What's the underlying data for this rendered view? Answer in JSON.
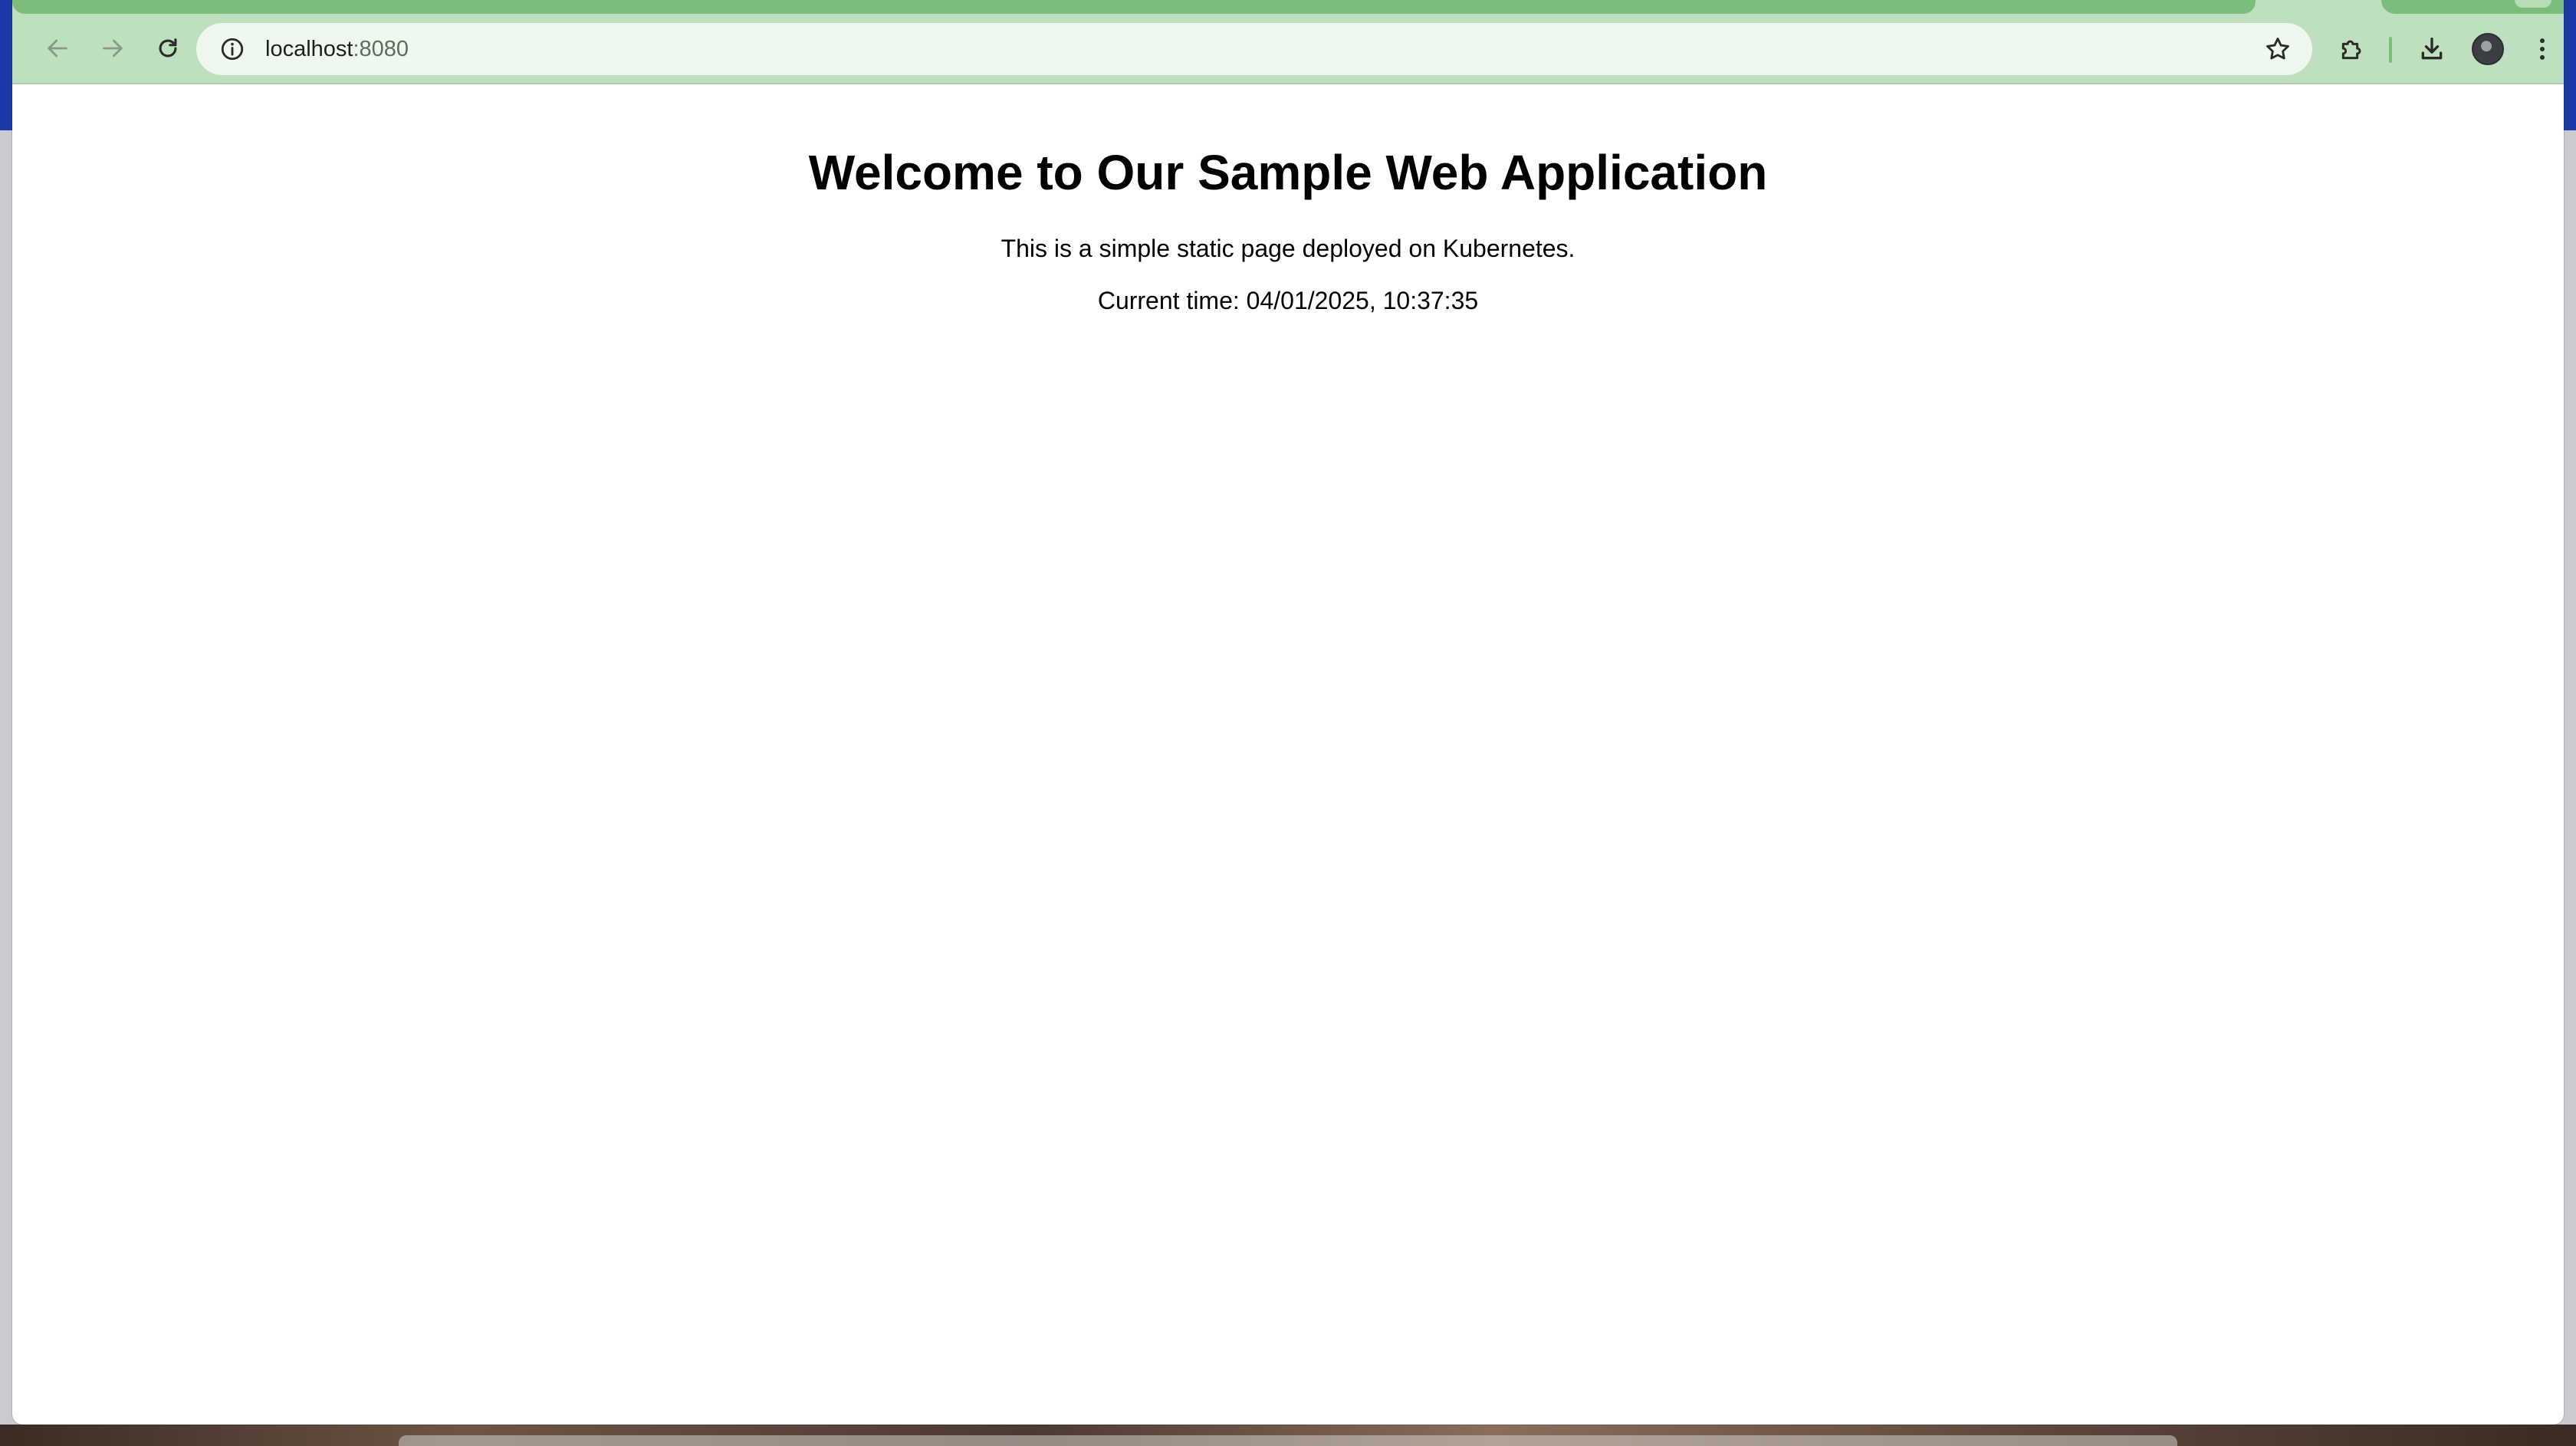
{
  "browser": {
    "address_bar": {
      "host": "localhost",
      "port": ":8080"
    },
    "icons": {
      "back": "back-arrow-icon",
      "forward": "forward-arrow-icon",
      "reload": "reload-icon",
      "site_info": "info-icon",
      "bookmark": "star-icon",
      "extensions": "puzzle-icon",
      "downloads": "download-icon",
      "profile": "avatar",
      "menu": "kebab-menu-icon"
    },
    "colors": {
      "frame": "#bfe0bf",
      "active_tab": "#7dbd7b",
      "omnibox": "#eef8ee"
    }
  },
  "page": {
    "title": "Welcome to Our Sample Web Application",
    "description": "This is a simple static page deployed on Kubernetes.",
    "current_time": "Current time: 04/01/2025, 10:37:35"
  }
}
